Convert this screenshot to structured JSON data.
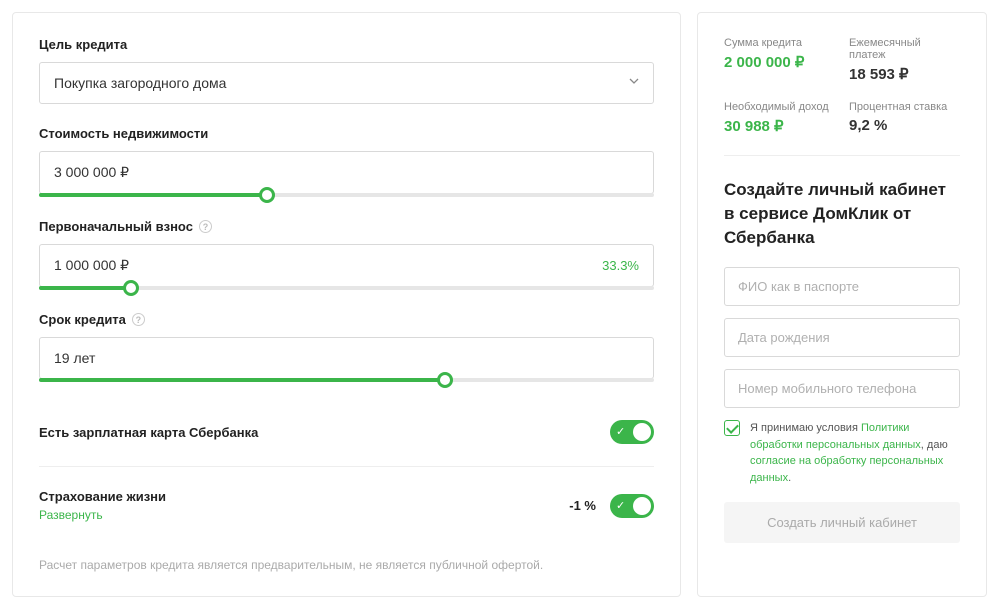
{
  "left": {
    "purpose_label": "Цель кредита",
    "purpose_value": "Покупка загородного дома",
    "cost_label": "Стоимость недвижимости",
    "cost_value": "3 000 000 ₽",
    "cost_slider_pct": 37,
    "down_label": "Первоначальный взнос",
    "down_value": "1 000 000 ₽",
    "down_pct": "33.3%",
    "down_slider_pct": 15,
    "term_label": "Срок кредита",
    "term_value": "19 лет",
    "term_slider_pct": 66,
    "salary_card_label": "Есть зарплатная карта Сбербанка",
    "insurance_label": "Страхование жизни",
    "insurance_expand": "Развернуть",
    "insurance_discount": "-1 %",
    "disclaimer": "Расчет параметров кредита является предварительным, не является публичной офертой."
  },
  "right": {
    "sum_amount_label": "Сумма кредита",
    "sum_amount_value": "2 000 000 ₽",
    "monthly_label": "Ежемесячный платеж",
    "monthly_value": "18 593 ₽",
    "income_label": "Необходимый доход",
    "income_value": "30 988 ₽",
    "rate_label": "Процентная ставка",
    "rate_value": "9,2 %",
    "cta_title": "Создайте личный кабинет в сервисе ДомКлик от Сбербанка",
    "name_placeholder": "ФИО как в паспорте",
    "dob_placeholder": "Дата рождения",
    "phone_placeholder": "Номер мобильного телефона",
    "consent_prefix": "Я принимаю условия ",
    "consent_link1": "Политики обработки персональных данных",
    "consent_mid": ", даю ",
    "consent_link2": "согласие на обработку персональных данных",
    "consent_suffix": ".",
    "submit_label": "Создать личный кабинет"
  }
}
